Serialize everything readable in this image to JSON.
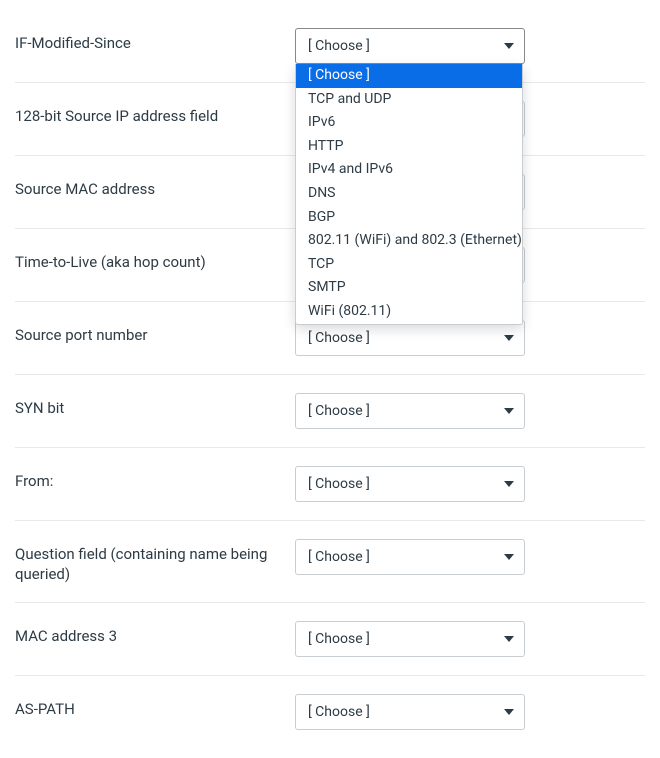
{
  "select_placeholder": "[ Choose ]",
  "dropdown_options": [
    "[ Choose ]",
    "TCP and UDP",
    "IPv6",
    "HTTP",
    "IPv4 and IPv6",
    "DNS",
    "BGP",
    "802.11 (WiFi) and 802.3 (Ethernet)",
    "TCP",
    "SMTP",
    "WiFi (802.11)"
  ],
  "dropdown_selected_index": 0,
  "rows": [
    {
      "label": "IF-Modified-Since",
      "value": "[ Choose ]",
      "open": true
    },
    {
      "label": "128-bit Source IP address field",
      "value": "[ Choose ]",
      "open": false
    },
    {
      "label": "Source MAC address",
      "value": "[ Choose ]",
      "open": false
    },
    {
      "label": "Time-to-Live (aka hop count)",
      "value": "[ Choose ]",
      "open": false
    },
    {
      "label": "Source port number",
      "value": "[ Choose ]",
      "open": false
    },
    {
      "label": "SYN bit",
      "value": "[ Choose ]",
      "open": false
    },
    {
      "label": "From:",
      "value": "[ Choose ]",
      "open": false
    },
    {
      "label": "Question field (containing name being queried)",
      "value": "[ Choose ]",
      "open": false
    },
    {
      "label": "MAC address 3",
      "value": "[ Choose ]",
      "open": false
    },
    {
      "label": "AS-PATH",
      "value": "[ Choose ]",
      "open": false
    }
  ]
}
